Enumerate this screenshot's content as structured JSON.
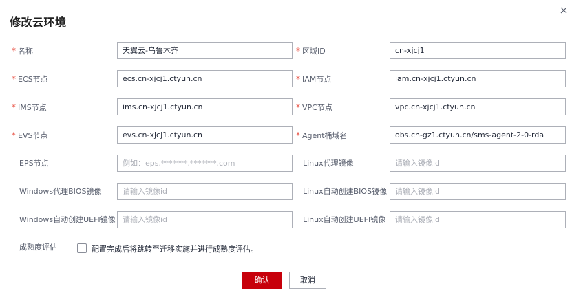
{
  "dialog": {
    "title": "修改云环境",
    "close_icon": "close-icon"
  },
  "form": {
    "name": {
      "label": "名称",
      "value": "天翼云-乌鲁木齐",
      "required": true
    },
    "region_id": {
      "label": "区域ID",
      "value": "cn-xjcj1",
      "required": true
    },
    "ecs_node": {
      "label": "ECS节点",
      "value": "ecs.cn-xjcj1.ctyun.cn",
      "required": true
    },
    "iam_node": {
      "label": "IAM节点",
      "value": "iam.cn-xjcj1.ctyun.cn",
      "required": true
    },
    "ims_node": {
      "label": "IMS节点",
      "value": "ims.cn-xjcj1.ctyun.cn",
      "required": true
    },
    "vpc_node": {
      "label": "VPC节点",
      "value": "vpc.cn-xjcj1.ctyun.cn",
      "required": true
    },
    "evs_node": {
      "label": "EVS节点",
      "value": "evs.cn-xjcj1.ctyun.cn",
      "required": true
    },
    "agent_bucket": {
      "label": "Agent桶域名",
      "value": "obs.cn-gz1.ctyun.cn/sms-agent-2-0-rda",
      "required": true
    },
    "eps_node": {
      "label": "EPS节点",
      "value": "",
      "placeholder": "例如：eps.*******.*******.com",
      "required": false
    },
    "linux_proxy_image": {
      "label": "Linux代理镜像",
      "value": "",
      "placeholder": "请输入镜像id",
      "required": false
    },
    "windows_proxy_bios_image": {
      "label": "Windows代理BIOS镜像",
      "value": "",
      "placeholder": "请输入镜像id",
      "required": false
    },
    "linux_auto_bios_image": {
      "label": "Linux自动创建BIOS镜像",
      "value": "",
      "placeholder": "请输入镜像id",
      "required": false
    },
    "windows_auto_uefi_image": {
      "label": "Windows自动创建UEFI镜像",
      "value": "",
      "placeholder": "请输入镜像id",
      "required": false
    },
    "linux_auto_uefi_image": {
      "label": "Linux自动创建UEFI镜像",
      "value": "",
      "placeholder": "请输入镜像id",
      "required": false
    },
    "maturity": {
      "label": "成熟度评估",
      "checkbox_text": "配置完成后将跳转至迁移实施并进行成熟度评估。",
      "checked": false
    }
  },
  "footer": {
    "confirm_label": "确认",
    "cancel_label": "取消"
  },
  "colors": {
    "required_star": "#e84e40",
    "primary_button": "#c7000b",
    "input_border": "#adb0b8",
    "placeholder": "#adb0b8"
  }
}
